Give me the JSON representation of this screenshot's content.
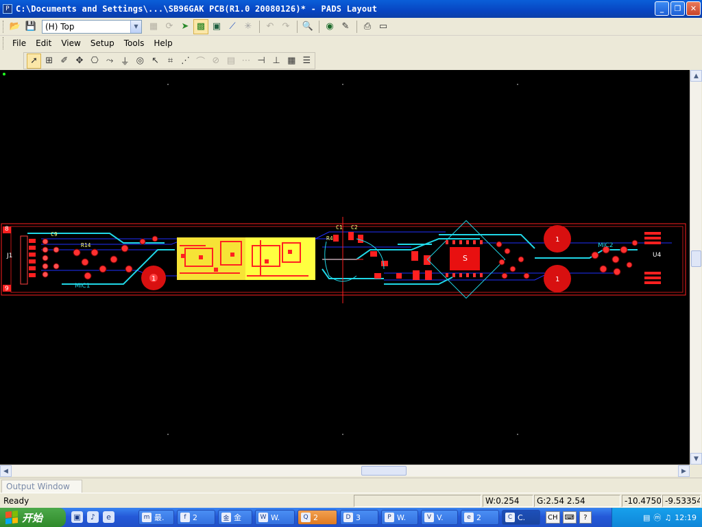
{
  "window": {
    "title": "C:\\Documents and Settings\\...\\SB96GAK PCB(R1.0 20080126)* - PADS Layout",
    "app_icon": "pads-app-icon",
    "controls": [
      "minimize-icon",
      "restore-icon",
      "close-icon"
    ]
  },
  "toolbar": {
    "layer_value": "(H) Top",
    "icons": [
      "open-icon",
      "save-icon",
      "layer-dropdown",
      "undo-history-icon",
      "refresh-icon",
      "route-icon",
      "display-colors-icon",
      "board-icon",
      "wire-icon",
      "star-icon",
      "undo-icon",
      "redo-icon",
      "zoom-icon",
      "view-icon",
      "highlight-icon",
      "print-icon",
      "window-icon"
    ]
  },
  "menu": {
    "items": [
      "File",
      "Edit",
      "View",
      "Setup",
      "Tools",
      "Help"
    ]
  },
  "design_toolbar": {
    "icons": [
      "select-icon",
      "area-select-icon",
      "drafting-icon",
      "move-icon",
      "component-icon",
      "route-tool-icon",
      "via-icon",
      "copper-icon",
      "arrow-icon",
      "dimension-icon",
      "net-icon",
      "trace-icon",
      "split-icon",
      "drc-icon",
      "stitch-icon",
      "pin-icon",
      "length-icon",
      "grid-icon",
      "report-icon"
    ]
  },
  "board": {
    "labels": {
      "connector": "J1",
      "pin_top": "8",
      "pin_bottom": "9",
      "mic_left": "MIC1",
      "mic_right": "MIC2",
      "ic": "U4",
      "chip": "S",
      "hole": "1",
      "cap_c9": "C9",
      "cap_c1": "C1",
      "cap_c2": "C2",
      "res_r14": "R14",
      "res_r4": "R4"
    },
    "colors": {
      "background": "#000000",
      "outline": "#ff2020",
      "top_copper": "#e81010",
      "bottom_trace": "#20d8e8",
      "inner_trace": "#2030ff",
      "silk": "#ffff40",
      "pads": "#ff3030"
    }
  },
  "output_window": {
    "tab_label": "Output Window"
  },
  "status": {
    "ready": "Ready",
    "width": "W:0.254",
    "grid": "G:2.54 2.54",
    "x": "-10.4750 ",
    "y": "-9.53354"
  },
  "taskbar": {
    "start_label": "开始",
    "quick_launch": [
      "desktop-icon",
      "media-icon",
      "ie-icon"
    ],
    "tasks": [
      {
        "icon": "m",
        "label": "最."
      },
      {
        "icon": "f",
        "label": "2"
      },
      {
        "icon": "金",
        "label": "金"
      },
      {
        "icon": "W",
        "label": "W."
      },
      {
        "icon": "Q",
        "label": "2"
      },
      {
        "icon": "D",
        "label": "3"
      },
      {
        "icon": "P",
        "label": "W."
      },
      {
        "icon": "V",
        "label": "V."
      },
      {
        "icon": "e",
        "label": "2"
      },
      {
        "icon": "C",
        "label": "C."
      }
    ],
    "ime": [
      "CH",
      "kbd",
      "?"
    ],
    "clock": "12:19"
  }
}
